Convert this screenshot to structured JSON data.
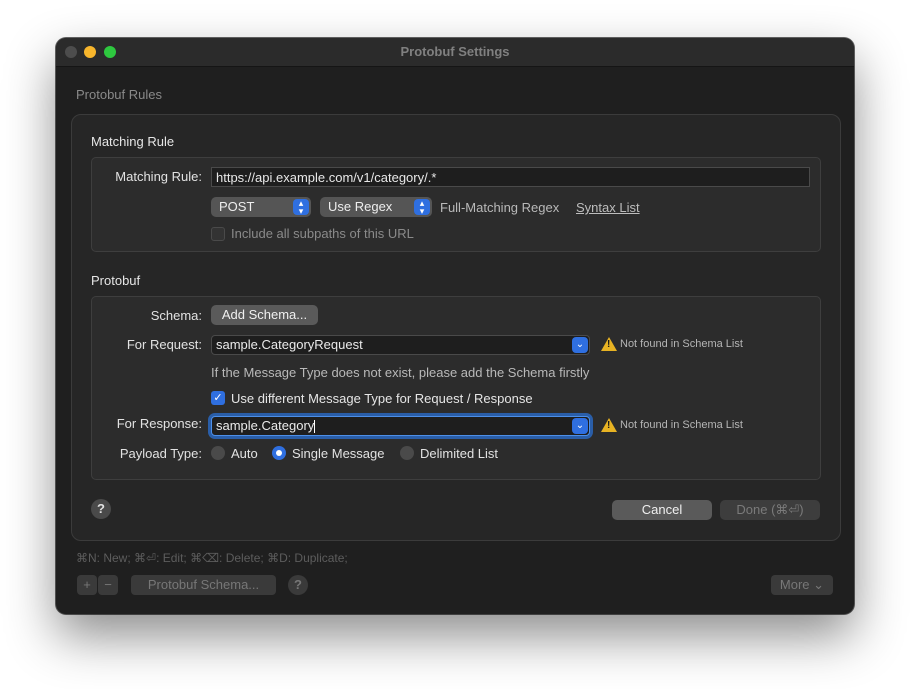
{
  "window": {
    "title": "Protobuf Settings"
  },
  "background": {
    "section_title": "Protobuf Rules",
    "shortcut_hint": "⌘N: New; ⌘⏎: Edit; ⌘⌫: Delete; ⌘D: Duplicate;"
  },
  "bottom_bar": {
    "add_label": "+",
    "remove_label": "−",
    "schema_button": "Protobuf Schema...",
    "help_label": "?",
    "more_label": "More",
    "more_chevron": "⌄"
  },
  "matching": {
    "group_title": "Matching Rule",
    "rule_label": "Matching Rule:",
    "rule_value": "https://api.example.com/v1/category/.*",
    "method_value": "POST",
    "mode_value": "Use Regex",
    "full_match_text": "Full-Matching Regex",
    "syntax_link": "Syntax List",
    "include_subpaths_label": "Include all subpaths of this URL",
    "include_subpaths_checked": false,
    "stepper_glyph": "⌃⌄"
  },
  "protobuf": {
    "group_title": "Protobuf",
    "schema_label": "Schema:",
    "add_schema_button": "Add Schema...",
    "request_label": "For Request:",
    "request_value": "sample.CategoryRequest",
    "request_warning": "Not found in Schema List",
    "help_text": "If the Message Type does not exist, please add the Schema firstly",
    "different_type_label": "Use different Message Type for Request / Response",
    "different_type_checked": true,
    "response_label": "For Response:",
    "response_value": "sample.Category",
    "response_warning": "Not found in Schema List",
    "payload_label": "Payload Type:",
    "payload_options": [
      "Auto",
      "Single Message",
      "Delimited List"
    ],
    "payload_selected": "Single Message",
    "drop_glyph": "⌄",
    "warning_glyph": "!",
    "check_glyph": "✓"
  },
  "footer": {
    "help_label": "?",
    "cancel_button": "Cancel",
    "done_button": "Done (⌘⏎)"
  }
}
